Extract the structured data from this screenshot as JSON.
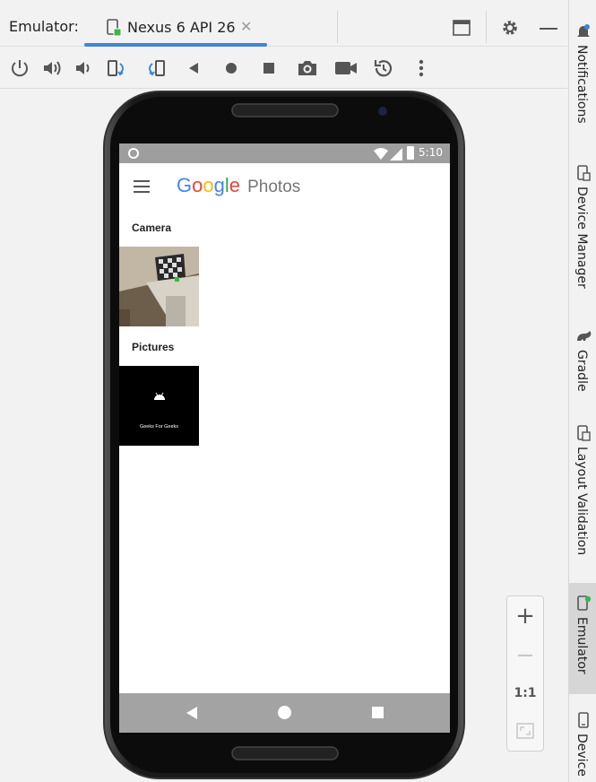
{
  "window": {
    "label": "Emulator:",
    "tab_title": "Nexus 6 API 26",
    "tab_close": "✕"
  },
  "toolbar": {
    "buttons": [
      "power-icon",
      "volume-up-icon",
      "volume-down-icon",
      "rotate-left-icon",
      "rotate-right-icon",
      "back-icon",
      "home-icon",
      "overview-icon",
      "screenshot-icon",
      "screen-record-icon",
      "snapshot-icon",
      "more-icon"
    ]
  },
  "sidebar": {
    "items": [
      {
        "label": "Notifications",
        "icon": "bell-icon"
      },
      {
        "label": "Device Manager",
        "icon": "device-manager-icon"
      },
      {
        "label": "Gradle",
        "icon": "gradle-icon"
      },
      {
        "label": "Layout Validation",
        "icon": "layout-validation-icon"
      },
      {
        "label": "Emulator",
        "icon": "emulator-icon",
        "active": true
      },
      {
        "label": "Device",
        "icon": "device-icon"
      }
    ]
  },
  "device": {
    "status_time": "5:10",
    "app": {
      "logo_letters": [
        {
          "ch": "G",
          "color": "#4285F4"
        },
        {
          "ch": "o",
          "color": "#EA4335"
        },
        {
          "ch": "o",
          "color": "#FBBC05"
        },
        {
          "ch": "g",
          "color": "#4285F4"
        },
        {
          "ch": "l",
          "color": "#34A853"
        },
        {
          "ch": "e",
          "color": "#EA4335"
        }
      ],
      "logo_suffix": "Photos",
      "sections": [
        {
          "title": "Camera"
        },
        {
          "title": "Pictures",
          "thumb_caption": "Geeks For Geeks"
        }
      ]
    }
  },
  "zoom": {
    "in": "+",
    "out": "−",
    "actual": "1:1"
  },
  "colors": {
    "accent": "#3f85d6",
    "statusbar": "#9e9e9e",
    "navbar": "#a3a3a3"
  }
}
